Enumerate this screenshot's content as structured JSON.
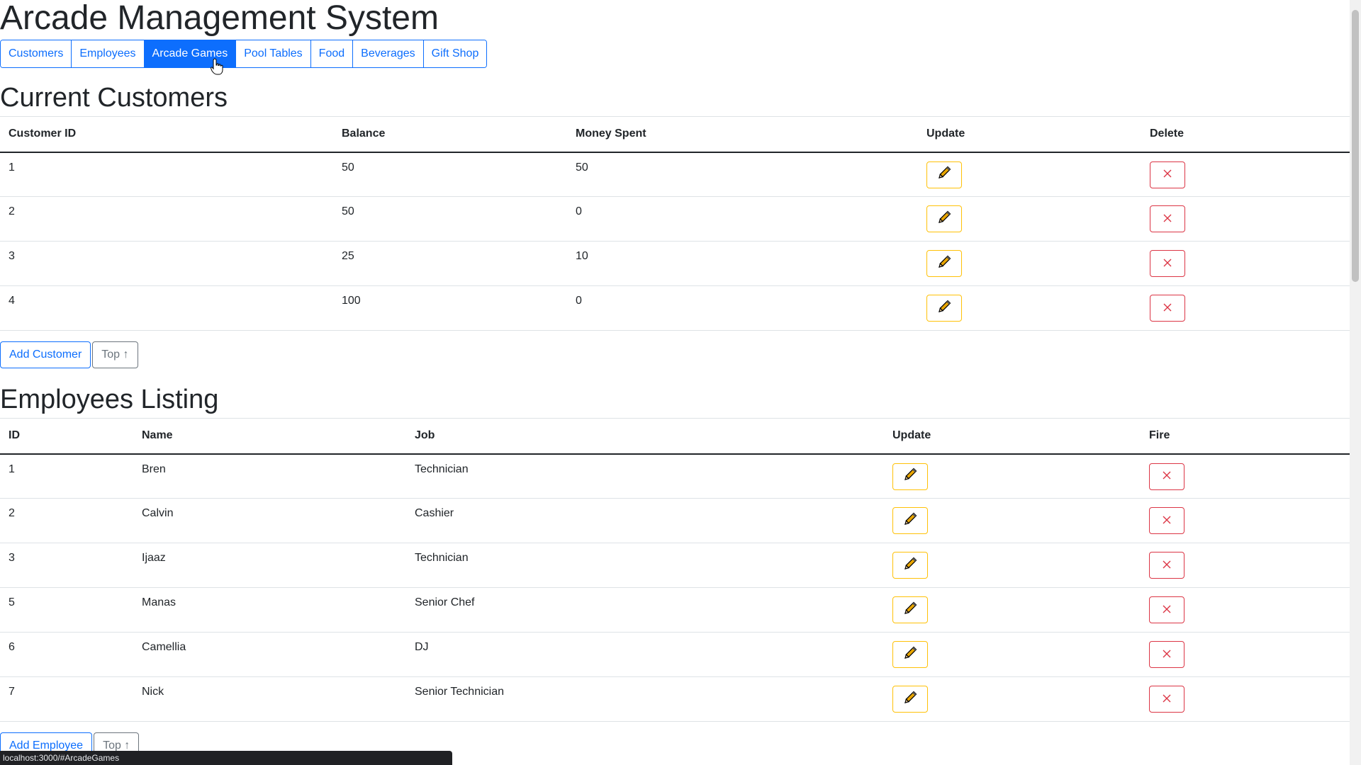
{
  "app": {
    "title": "Arcade Management System"
  },
  "nav": {
    "tabs": [
      {
        "label": "Customers",
        "active": false
      },
      {
        "label": "Employees",
        "active": false
      },
      {
        "label": "Arcade Games",
        "active": true
      },
      {
        "label": "Pool Tables",
        "active": false
      },
      {
        "label": "Food",
        "active": false
      },
      {
        "label": "Beverages",
        "active": false
      },
      {
        "label": "Gift Shop",
        "active": false
      }
    ]
  },
  "customers": {
    "title": "Current Customers",
    "columns": [
      "Customer ID",
      "Balance",
      "Money Spent",
      "Update",
      "Delete"
    ],
    "rows": [
      {
        "id": "1",
        "balance": "50",
        "spent": "50"
      },
      {
        "id": "2",
        "balance": "50",
        "spent": "0"
      },
      {
        "id": "3",
        "balance": "25",
        "spent": "10"
      },
      {
        "id": "4",
        "balance": "100",
        "spent": "0"
      }
    ],
    "add_label": "Add Customer",
    "top_label": "Top ↑"
  },
  "employees": {
    "title": "Employees Listing",
    "columns": [
      "ID",
      "Name",
      "Job",
      "Update",
      "Fire"
    ],
    "rows": [
      {
        "id": "1",
        "name": "Bren",
        "job": "Technician"
      },
      {
        "id": "2",
        "name": "Calvin",
        "job": "Cashier"
      },
      {
        "id": "3",
        "name": "Ijaaz",
        "job": "Technician"
      },
      {
        "id": "5",
        "name": "Manas",
        "job": "Senior Chef"
      },
      {
        "id": "6",
        "name": "Camellia",
        "job": "DJ"
      },
      {
        "id": "7",
        "name": "Nick",
        "job": "Senior Technician"
      }
    ],
    "add_label": "Add Employee",
    "top_label": "Top ↑"
  },
  "icons": {
    "edit": "pencil-icon",
    "delete": "close-icon",
    "cursor": "hand-pointer-icon"
  },
  "colors": {
    "primary": "#0d6efd",
    "warning": "#ffc107",
    "danger": "#dc3545",
    "secondary": "#6c757d"
  },
  "status_bar": {
    "url": "localhost:3000/#ArcadeGames"
  }
}
